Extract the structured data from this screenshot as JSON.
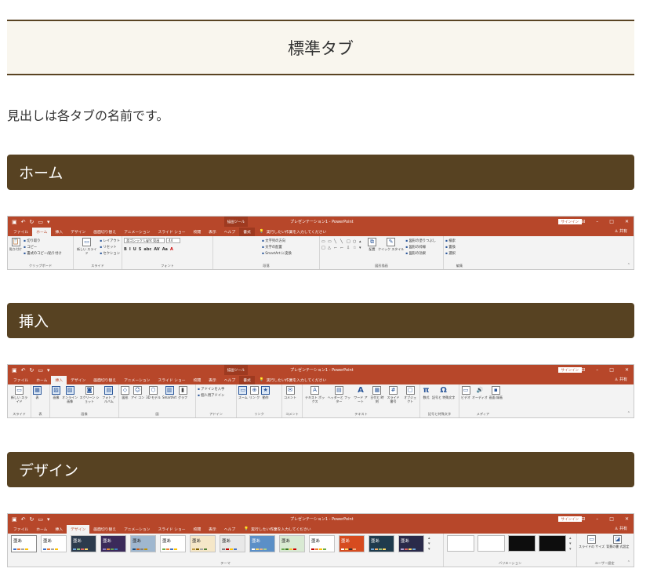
{
  "page": {
    "title": "標準タブ",
    "intro": "見出しは各タブの名前です。"
  },
  "sections": [
    {
      "heading": "ホーム"
    },
    {
      "heading": "挿入"
    },
    {
      "heading": "デザイン"
    }
  ],
  "ribbon": {
    "doc_title": "プレゼンテーション1 - PowerPoint",
    "context_tool": "描画ツール",
    "context_tab": "書式",
    "sign_in": "サインイン",
    "share": "共有",
    "tell_me": "実行したい作業を入力してください",
    "tabs": [
      "ファイル",
      "ホーム",
      "挿入",
      "デザイン",
      "画面切り替え",
      "アニメーション",
      "スライド ショー",
      "校閲",
      "表示",
      "ヘルプ"
    ],
    "home": {
      "active_tab": "ホーム",
      "groups": {
        "clipboard": {
          "label": "クリップボード",
          "paste": "貼り付け",
          "items": [
            "切り取り",
            "コピー",
            "書式のコピー/貼り付け"
          ]
        },
        "slides": {
          "label": "スライド",
          "new": "新しい スライド",
          "items": [
            "レイアウト",
            "リセット",
            "セクション"
          ]
        },
        "font": {
          "label": "フォント",
          "name": "游ゴシック Light 見出",
          "size": "44",
          "minis": [
            "B",
            "I",
            "U",
            "S",
            "abc",
            "AV",
            "Aa",
            "A"
          ]
        },
        "paragraph": {
          "label": "段落",
          "items": [
            "文字列の方向",
            "文字の配置",
            "SmartArt に変換"
          ]
        },
        "drawing": {
          "label": "図形描画",
          "arrange": "配置",
          "quick": "クイック スタイル",
          "items": [
            "図形の塗りつぶし",
            "図形の枠線",
            "図形の効果"
          ]
        },
        "editing": {
          "label": "編集",
          "items": [
            "検索",
            "置換",
            "選択"
          ]
        }
      }
    },
    "insert": {
      "active_tab": "挿入",
      "groups": [
        {
          "label": "スライド",
          "buttons": [
            "新しい スライド"
          ]
        },
        {
          "label": "表",
          "buttons": [
            "表"
          ]
        },
        {
          "label": "画像",
          "buttons": [
            "画像",
            "オンライン 画像",
            "スクリーン ショット",
            "フォト アルバム"
          ]
        },
        {
          "label": "図",
          "buttons": [
            "図形",
            "アイ コン",
            "3D モデル",
            "SmartArt",
            "グラフ"
          ]
        },
        {
          "label": "アドイン",
          "buttons": [
            "アドインを入手",
            "個人用アドイン"
          ]
        },
        {
          "label": "リンク",
          "buttons": [
            "ズーム",
            "リン ク",
            "動作"
          ]
        },
        {
          "label": "コメント",
          "buttons": [
            "コメント"
          ]
        },
        {
          "label": "テキスト",
          "buttons": [
            "テキスト ボックス",
            "ヘッダーと フッター",
            "ワード アート",
            "日付と 時刻",
            "スライド番号",
            "オブジェクト"
          ]
        },
        {
          "label": "記号と特殊文字",
          "buttons": [
            "数式",
            "記号と 特殊文字"
          ]
        },
        {
          "label": "メディア",
          "buttons": [
            "ビデオ",
            "オーディオ",
            "画面 録画"
          ]
        }
      ]
    },
    "design": {
      "active_tab": "デザイン",
      "theme_label": "テーマ",
      "variant_label": "バリエーション",
      "user_label": "ユーザー設定",
      "theme_glyph": "亜あ",
      "user_buttons": [
        "スライドの サイズ",
        "背景の書 式設定"
      ]
    }
  }
}
